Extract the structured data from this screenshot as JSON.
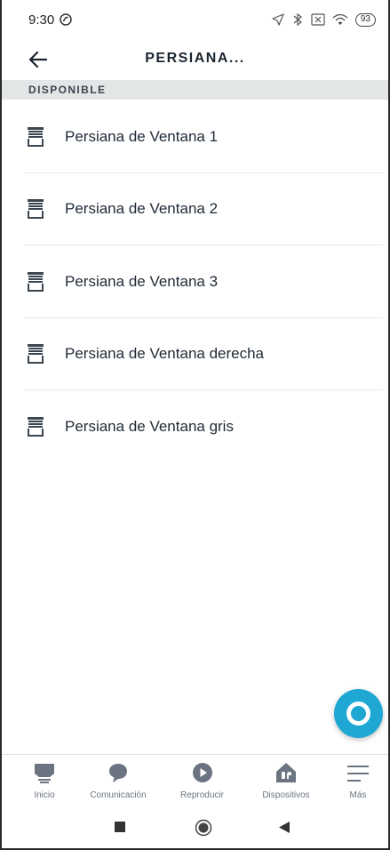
{
  "status_bar": {
    "time": "9:30",
    "battery": "93"
  },
  "header": {
    "title": "PERSIANA..."
  },
  "section": {
    "label": "DISPONIBLE"
  },
  "devices": [
    {
      "label": "Persiana de Ventana 1"
    },
    {
      "label": "Persiana de Ventana 2"
    },
    {
      "label": "Persiana de Ventana 3"
    },
    {
      "label": "Persiana de Ventana derecha"
    },
    {
      "label": "Persiana de Ventana gris"
    }
  ],
  "bottom_nav": {
    "items": [
      {
        "label": "Inicio",
        "icon": "home-icon"
      },
      {
        "label": "Comunicación",
        "icon": "chat-bubble-icon"
      },
      {
        "label": "Reproducir",
        "icon": "play-icon"
      },
      {
        "label": "Dispositivos",
        "icon": "devices-house-icon"
      },
      {
        "label": "Más",
        "icon": "menu-icon"
      }
    ]
  },
  "colors": {
    "accent": "#1fa7d4",
    "nav_icon": "#6b7480",
    "section_bg": "#e3e6e6"
  }
}
